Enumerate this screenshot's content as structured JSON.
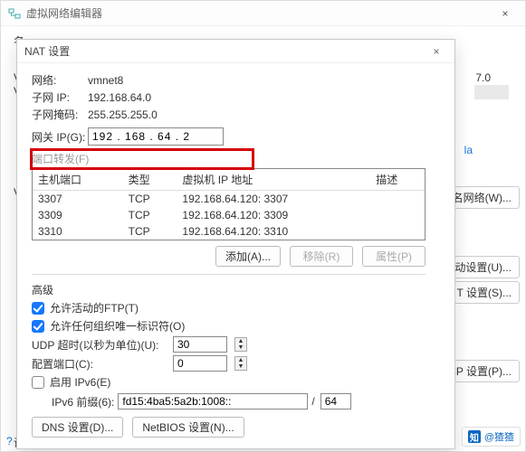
{
  "parent": {
    "title": "虚拟网络编辑器",
    "close": "×",
    "frag_70": "7.0",
    "frag_la": "la",
    "btn_rename": "命名网络(W)...",
    "btn_auto_set": "动设置(U)...",
    "btn_nat_set": "T 设置(S)...",
    "btn_cp_set": "CP 设置(P)...",
    "btn_edge": "设"
  },
  "dlg": {
    "title": "NAT 设置",
    "close": "×",
    "network_lbl": "网络:",
    "network_val": "vmnet8",
    "subnet_ip_lbl": "子网 IP:",
    "subnet_ip_val": "192.168.64.0",
    "subnet_mask_lbl": "子网掩码:",
    "subnet_mask_val": "255.255.255.0",
    "gateway_lbl": "网关 IP(G):",
    "gateway_val": "192 . 168 . 64 . 2",
    "portfwd_lbl": "端口转发(F)",
    "table": {
      "headers": [
        "主机端口",
        "类型",
        "虚拟机 IP 地址",
        "描述"
      ],
      "rows": [
        [
          "3307",
          "TCP",
          "192.168.64.120: 3307",
          ""
        ],
        [
          "3309",
          "TCP",
          "192.168.64.120: 3309",
          ""
        ],
        [
          "3310",
          "TCP",
          "192.168.64.120: 3310",
          ""
        ]
      ]
    },
    "btn_add": "添加(A)...",
    "btn_remove": "移除(R)",
    "btn_props": "属性(P)",
    "advanced_lbl": "高级",
    "allow_ftp": "允许活动的FTP(T)",
    "allow_oui": "允许任何组织唯一标识符(O)",
    "udp_timeout_lbl": "UDP 超时(以秒为单位)(U):",
    "udp_timeout_val": "30",
    "cfg_port_lbl": "配置端口(C):",
    "cfg_port_val": "0",
    "enable_ipv6": "启用 IPv6(E)",
    "ipv6_prefix_lbl": "IPv6 前缀(6):",
    "ipv6_prefix_val": "fd15:4ba5:5a2b:1008::",
    "ipv6_prefix_len": "64",
    "btn_dns": "DNS 设置(D)...",
    "btn_netbios": "NetBIOS 设置(N)..."
  },
  "watermark": "@猹猹"
}
